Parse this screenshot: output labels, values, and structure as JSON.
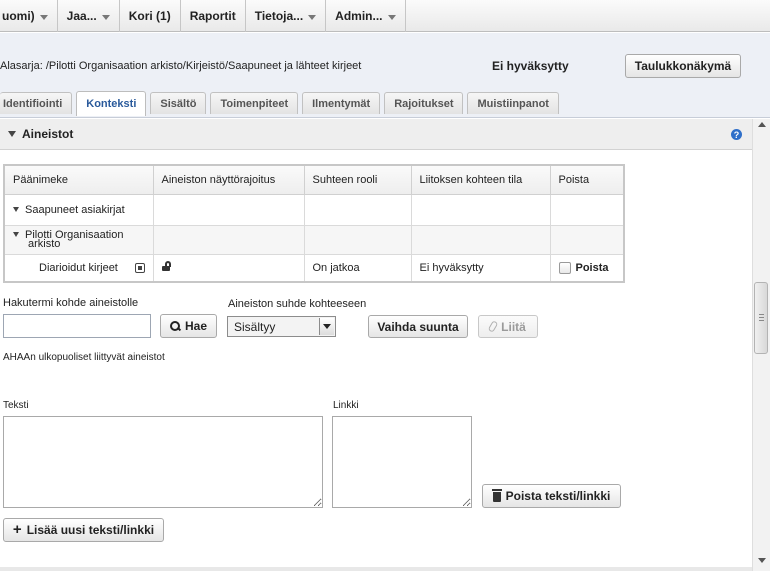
{
  "menu": [
    {
      "label": "uomi)",
      "has_dropdown": true
    },
    {
      "label": "Jaa...",
      "has_dropdown": true
    },
    {
      "label": "Kori (1)",
      "has_dropdown": false
    },
    {
      "label": "Raportit",
      "has_dropdown": false
    },
    {
      "label": "Tietoja...",
      "has_dropdown": true
    },
    {
      "label": "Admin...",
      "has_dropdown": true
    }
  ],
  "header": {
    "series_path": "Alasarja: /Pilotti Organisaation arkisto/Kirjeistö/Saapuneet ja lähteet kirjeet",
    "status": "Ei hyväksytty",
    "table_view_button": "Taulukkonäkymä"
  },
  "tabs": [
    {
      "label": "Identifiointi",
      "active": false
    },
    {
      "label": "Konteksti",
      "active": true
    },
    {
      "label": "Sisältö",
      "active": false
    },
    {
      "label": "Toimenpiteet",
      "active": false
    },
    {
      "label": "Ilmentymät",
      "active": false
    },
    {
      "label": "Rajoitukset",
      "active": false
    },
    {
      "label": "Muistiinpanot",
      "active": false
    }
  ],
  "section": {
    "title": "Aineistot",
    "help_glyph": "?"
  },
  "table": {
    "headers": [
      "Päänimeke",
      "Aineiston näyttörajoitus",
      "Suhteen rooli",
      "Liitoksen kohteen tila",
      "Poista"
    ],
    "rows": [
      {
        "title": "Saapuneet asiakirjat",
        "expanded": true
      },
      {
        "title_line1": "Pilotti Organisaation",
        "title_line2": "arkisto",
        "expanded": true
      },
      {
        "title": "Diarioidut kirjeet",
        "role": "On jatkoa",
        "target_state": "Ei hyväksytty",
        "delete_label": "Poista",
        "delete_checked": false
      }
    ]
  },
  "search": {
    "label": "Hakutermi kohde aineistolle",
    "value": "",
    "button": "Hae",
    "relation_label": "Aineiston suhde kohteeseen",
    "relation_selected": "Sisältyy",
    "switch_button": "Vaihda suunta",
    "attach_button": "Liitä"
  },
  "external": {
    "heading": "AHAAn ulkopuoliset liittyvät aineistot",
    "text_label": "Teksti",
    "link_label": "Linkki",
    "text_value": "",
    "link_value": "",
    "remove_button": "Poista teksti/linkki",
    "add_button": "Lisää uusi teksti/linkki"
  }
}
